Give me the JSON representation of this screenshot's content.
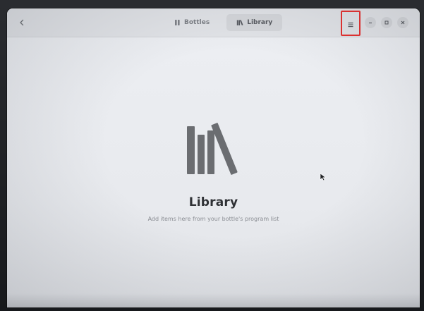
{
  "app": {
    "name": "Bottles"
  },
  "headerbar": {
    "back_icon": "go-back-icon",
    "tabs": [
      {
        "label": "Bottles",
        "icon": "bottles-icon",
        "active": false
      },
      {
        "label": "Library",
        "icon": "library-icon",
        "active": true
      }
    ],
    "menu_icon": "hamburger-menu-icon",
    "window_controls": [
      "minimize",
      "maximize",
      "close"
    ]
  },
  "status_page": {
    "icon": "library-books-icon",
    "title": "Library",
    "description": "Add items here from your bottle's program list"
  },
  "colors": {
    "window_bg": "#e6e8ec",
    "headerbar_bg": "#e1e3e7",
    "title_text": "#2f3135",
    "desc_text": "#8a8d93",
    "icon_gray": "#6b6d71",
    "highlight_box": "#e5302f"
  }
}
